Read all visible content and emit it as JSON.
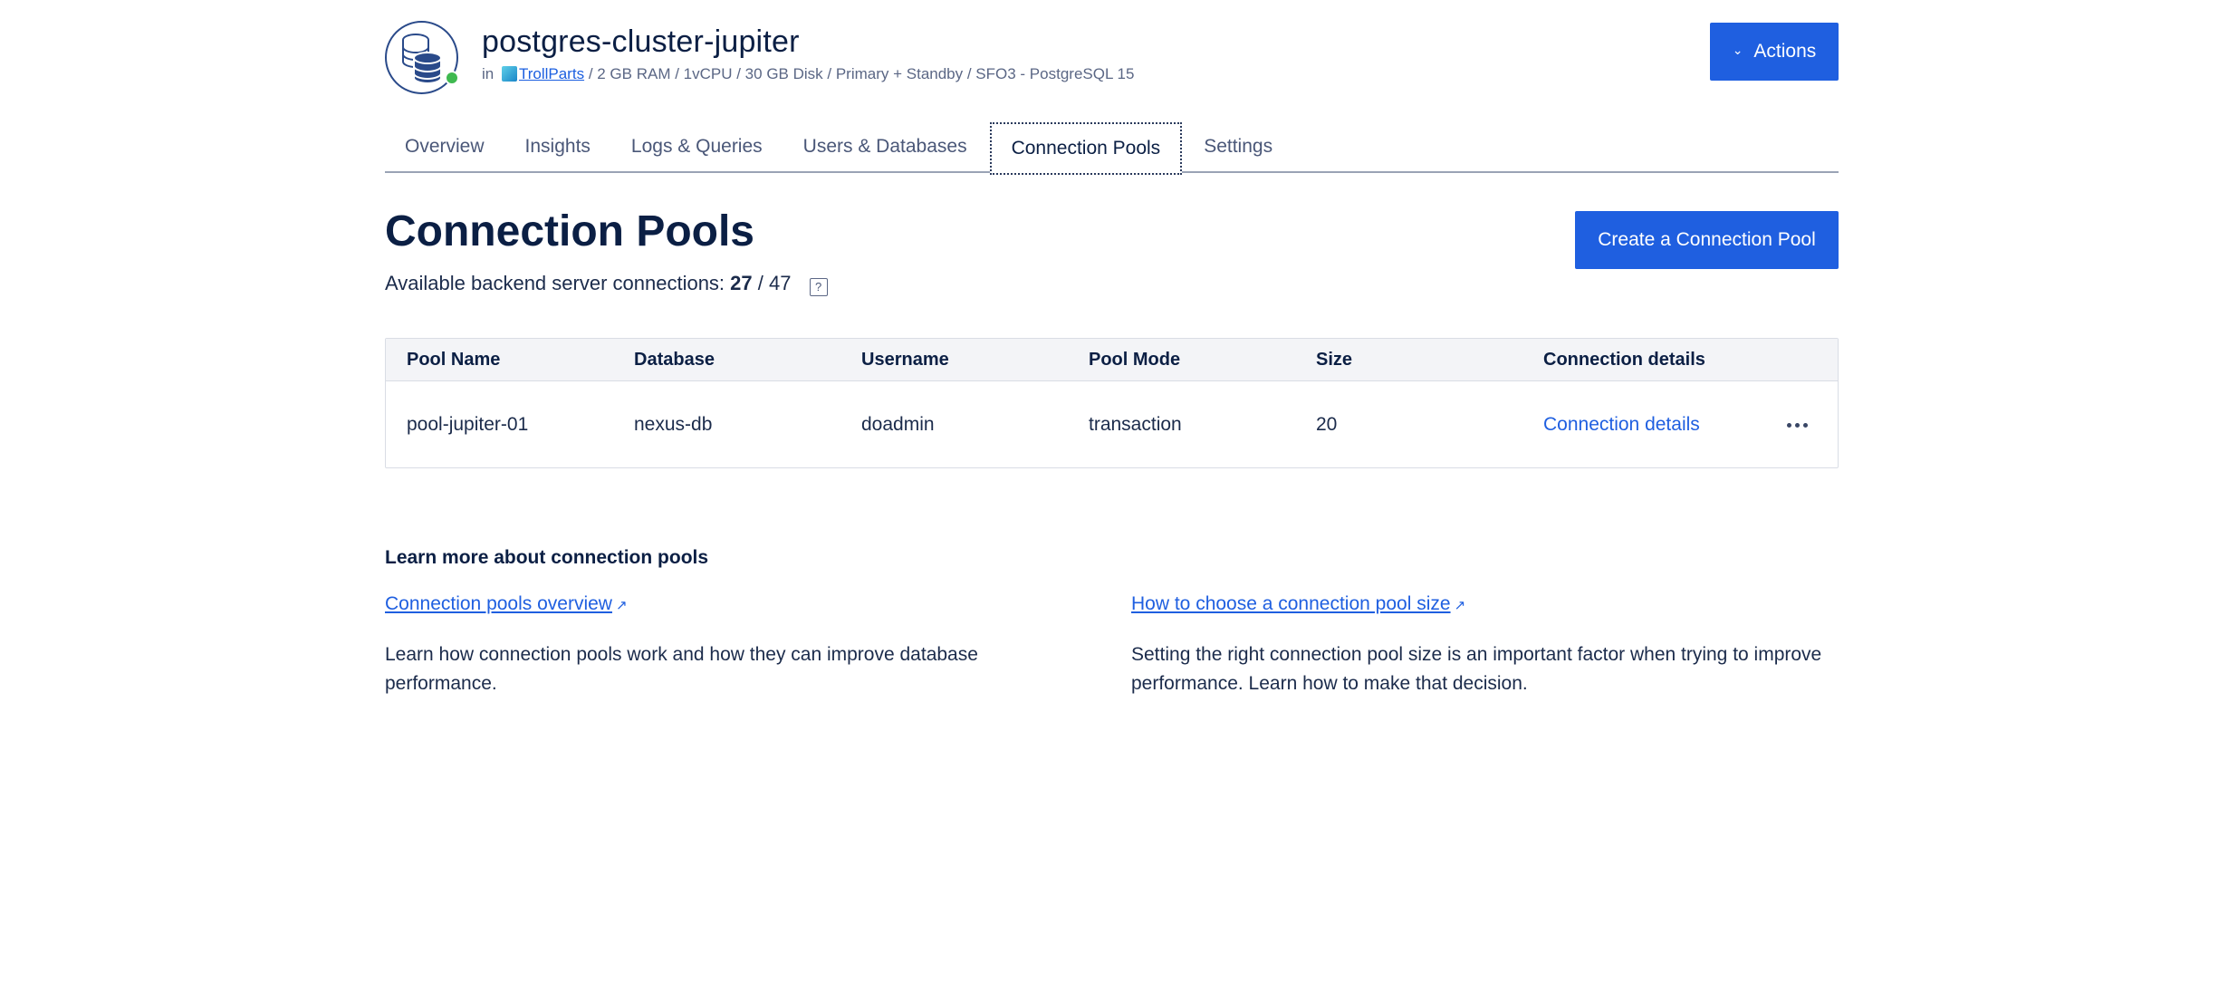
{
  "header": {
    "title": "postgres-cluster-jupiter",
    "meta_prefix": "in",
    "team_link": "TrollParts",
    "meta_details": "/ 2 GB RAM / 1vCPU / 30 GB Disk / Primary + Standby / SFO3 - PostgreSQL 15",
    "status_color": "#3fb950",
    "actions_label": "Actions",
    "actions_icon": "chevron-down-icon"
  },
  "tabs": [
    {
      "label": "Overview"
    },
    {
      "label": "Insights"
    },
    {
      "label": "Logs & Queries"
    },
    {
      "label": "Users & Databases"
    },
    {
      "label": "Connection Pools",
      "active": true
    },
    {
      "label": "Settings"
    }
  ],
  "section": {
    "title": "Connection Pools",
    "create_button": "Create a Connection Pool",
    "available_label": "Available backend server connections:",
    "available_used": "27",
    "available_sep": "/",
    "available_total": "47",
    "help_glyph": "?"
  },
  "table": {
    "headers": [
      "Pool Name",
      "Database",
      "Username",
      "Pool Mode",
      "Size",
      "Connection details"
    ],
    "rows": [
      {
        "pool_name": "pool-jupiter-01",
        "database": "nexus-db",
        "username": "doadmin",
        "pool_mode": "transaction",
        "size": "20",
        "details_link": "Connection details"
      }
    ]
  },
  "learn": {
    "title": "Learn more about connection pools",
    "left": {
      "link": "Connection pools overview",
      "desc": "Learn how connection pools work and how they can improve database performance."
    },
    "right": {
      "link": "How to choose a connection pool size",
      "desc": "Setting the right connection pool size is an important factor when trying to improve performance. Learn how to make that decision."
    }
  },
  "colors": {
    "accent": "#1f5fe0",
    "title": "#0b1f44"
  }
}
